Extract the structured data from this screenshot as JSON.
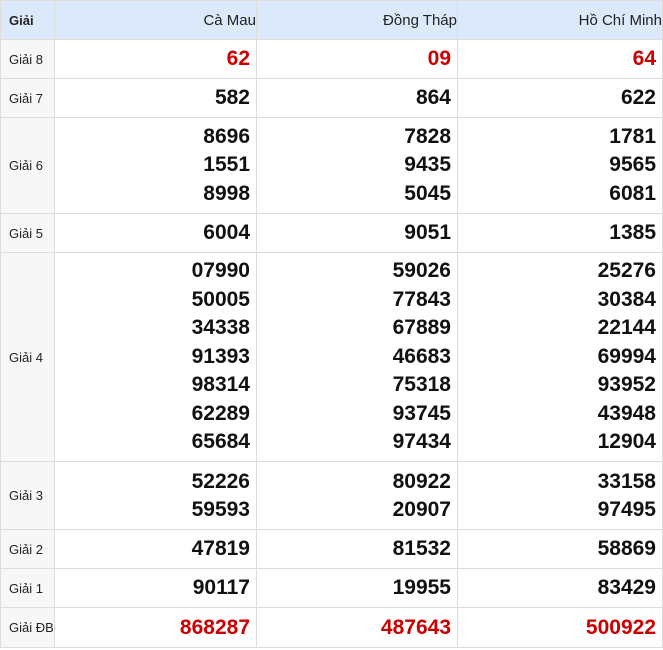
{
  "header": {
    "label": "Giải",
    "provinces": [
      "Cà Mau",
      "Đồng Tháp",
      "Hồ Chí Minh"
    ]
  },
  "rows": [
    {
      "label": "Giải 8",
      "highlight": true,
      "values": [
        [
          "62"
        ],
        [
          "09"
        ],
        [
          "64"
        ]
      ]
    },
    {
      "label": "Giải 7",
      "highlight": false,
      "values": [
        [
          "582"
        ],
        [
          "864"
        ],
        [
          "622"
        ]
      ]
    },
    {
      "label": "Giải 6",
      "highlight": false,
      "values": [
        [
          "8696",
          "1551",
          "8998"
        ],
        [
          "7828",
          "9435",
          "5045"
        ],
        [
          "1781",
          "9565",
          "6081"
        ]
      ]
    },
    {
      "label": "Giải 5",
      "highlight": false,
      "values": [
        [
          "6004"
        ],
        [
          "9051"
        ],
        [
          "1385"
        ]
      ]
    },
    {
      "label": "Giải 4",
      "highlight": false,
      "values": [
        [
          "07990",
          "50005",
          "34338",
          "91393",
          "98314",
          "62289",
          "65684"
        ],
        [
          "59026",
          "77843",
          "67889",
          "46683",
          "75318",
          "93745",
          "97434"
        ],
        [
          "25276",
          "30384",
          "22144",
          "69994",
          "93952",
          "43948",
          "12904"
        ]
      ]
    },
    {
      "label": "Giải 3",
      "highlight": false,
      "values": [
        [
          "52226",
          "59593"
        ],
        [
          "80922",
          "20907"
        ],
        [
          "33158",
          "97495"
        ]
      ]
    },
    {
      "label": "Giải 2",
      "highlight": false,
      "values": [
        [
          "47819"
        ],
        [
          "81532"
        ],
        [
          "58869"
        ]
      ]
    },
    {
      "label": "Giải 1",
      "highlight": false,
      "values": [
        [
          "90117"
        ],
        [
          "19955"
        ],
        [
          "83429"
        ]
      ]
    },
    {
      "label": "Giải ĐB",
      "highlight": true,
      "values": [
        [
          "868287"
        ],
        [
          "487643"
        ],
        [
          "500922"
        ]
      ]
    }
  ],
  "colors": {
    "header_bg": "#dbe9fb",
    "label_bg": "#f7f7f7",
    "highlight": "#cc0000",
    "border": "#dcdcdc"
  }
}
